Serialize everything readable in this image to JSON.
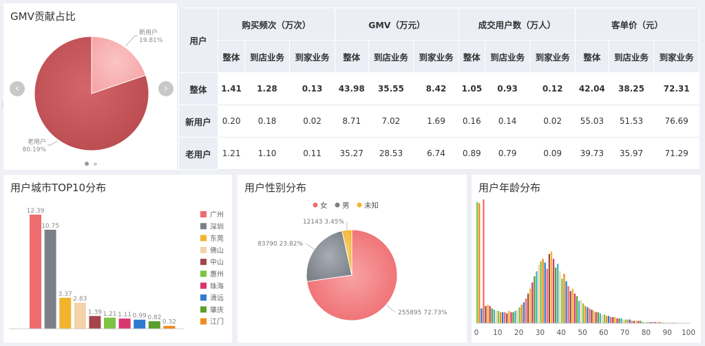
{
  "gmv_panel": {
    "title": "GMV贡献占比",
    "prev_icon": "chevron-left-icon",
    "next_icon": "chevron-right-icon"
  },
  "table": {
    "row_header": "用户",
    "groups": [
      "购买频次（万次）",
      "GMV（万元）",
      "成交用户数（万人）",
      "客单价（元）"
    ],
    "sub_headers": [
      "整体",
      "到店业务",
      "到家业务"
    ],
    "rows": [
      {
        "label": "整体",
        "values": [
          "1.41",
          "1.28",
          "0.13",
          "43.98",
          "35.55",
          "8.42",
          "1.05",
          "0.93",
          "0.12",
          "42.04",
          "38.25",
          "72.31"
        ]
      },
      {
        "label": "新用户",
        "values": [
          "0.20",
          "0.18",
          "0.02",
          "8.71",
          "7.02",
          "1.69",
          "0.16",
          "0.14",
          "0.02",
          "55.03",
          "51.53",
          "76.69"
        ]
      },
      {
        "label": "老用户",
        "values": [
          "1.21",
          "1.10",
          "0.11",
          "35.27",
          "28.53",
          "6.74",
          "0.89",
          "0.79",
          "0.09",
          "39.73",
          "35.97",
          "71.29"
        ]
      }
    ]
  },
  "city_panel": {
    "title": "用户城市TOP10分布"
  },
  "gender_panel": {
    "title": "用户性别分布"
  },
  "age_panel": {
    "title": "用户年龄分布"
  },
  "chart_data": [
    {
      "type": "pie",
      "title": "GMV贡献占比",
      "slices": [
        {
          "name": "新用户",
          "value": 19.81,
          "label": "19.81%",
          "color": "#f5a3a5"
        },
        {
          "name": "老用户",
          "value": 80.19,
          "label": "80.19%",
          "color": "#b84a4e"
        }
      ]
    },
    {
      "type": "bar",
      "title": "用户城市TOP10分布",
      "categories": [
        "广州",
        "深圳",
        "东莞",
        "佛山",
        "中山",
        "惠州",
        "珠海",
        "清远",
        "肇庆",
        "江门"
      ],
      "values": [
        12.39,
        10.75,
        3.37,
        2.83,
        1.39,
        1.21,
        1.11,
        0.99,
        0.82,
        0.32
      ],
      "colors": [
        "#ee6b6e",
        "#7b8088",
        "#f2b42c",
        "#f3d3a8",
        "#a3454a",
        "#7cc243",
        "#d9366e",
        "#2f79cf",
        "#5aa02c",
        "#f28a1e"
      ],
      "legend": "right"
    },
    {
      "type": "pie",
      "title": "用户性别分布",
      "legend": [
        "女",
        "男",
        "未知"
      ],
      "slices": [
        {
          "name": "女",
          "value": 255895,
          "percent": "72.73%",
          "color": "#ee6b6e"
        },
        {
          "name": "男",
          "value": 83790,
          "percent": "23.82%",
          "color": "#7b8088"
        },
        {
          "name": "未知",
          "value": 12143,
          "percent": "3.45%",
          "color": "#f2b42c"
        }
      ]
    },
    {
      "type": "bar",
      "title": "用户年龄分布",
      "x_ticks": [
        0,
        10,
        20,
        30,
        40,
        50,
        60,
        70,
        80,
        90,
        100
      ],
      "xlim": [
        0,
        100
      ],
      "x": [
        0,
        1,
        2,
        3,
        4,
        5,
        6,
        7,
        8,
        9,
        10,
        11,
        12,
        13,
        14,
        15,
        16,
        17,
        18,
        19,
        20,
        21,
        22,
        23,
        24,
        25,
        26,
        27,
        28,
        29,
        30,
        31,
        32,
        33,
        34,
        35,
        36,
        37,
        38,
        39,
        40,
        41,
        42,
        43,
        44,
        45,
        46,
        47,
        48,
        49,
        50,
        51,
        52,
        53,
        54,
        55,
        56,
        57,
        58,
        59,
        60,
        61,
        62,
        63,
        64,
        65,
        66,
        67,
        68,
        69,
        70,
        71,
        72,
        73,
        74,
        75,
        76,
        77,
        78,
        79,
        80,
        81,
        82,
        83,
        84,
        85,
        86,
        87,
        88,
        89,
        90,
        91,
        92,
        93,
        94,
        95,
        96,
        97,
        98,
        99,
        100
      ],
      "values": [
        98,
        97,
        12,
        100,
        14,
        15,
        14,
        12,
        11,
        10,
        10,
        9,
        9,
        9,
        8,
        10,
        9,
        9,
        10,
        11,
        13,
        15,
        17,
        20,
        24,
        28,
        33,
        38,
        42,
        47,
        50,
        52,
        49,
        44,
        56,
        58,
        52,
        45,
        48,
        42,
        36,
        40,
        34,
        30,
        26,
        28,
        24,
        22,
        18,
        19,
        16,
        14,
        13,
        12,
        11,
        10,
        9,
        9,
        8,
        7,
        7,
        6,
        6,
        5,
        5,
        5,
        4,
        4,
        4,
        3,
        3,
        3,
        3,
        2,
        2,
        2,
        2,
        2,
        1,
        1,
        1,
        1,
        1,
        1,
        1,
        1,
        1,
        0.6,
        0.6,
        0.6,
        0.5,
        0.5,
        0.5,
        0.4,
        0.4,
        0.4,
        0.3,
        0.3,
        0.3,
        0.3,
        0.2
      ],
      "colors": [
        "#7cc243",
        "#f28a1e",
        "#2f79cf",
        "#ee6b6e",
        "#a3454a",
        "#f2b42c",
        "#d9366e",
        "#5aa02c",
        "#3ab5c6",
        "#f3d3a8"
      ]
    }
  ]
}
